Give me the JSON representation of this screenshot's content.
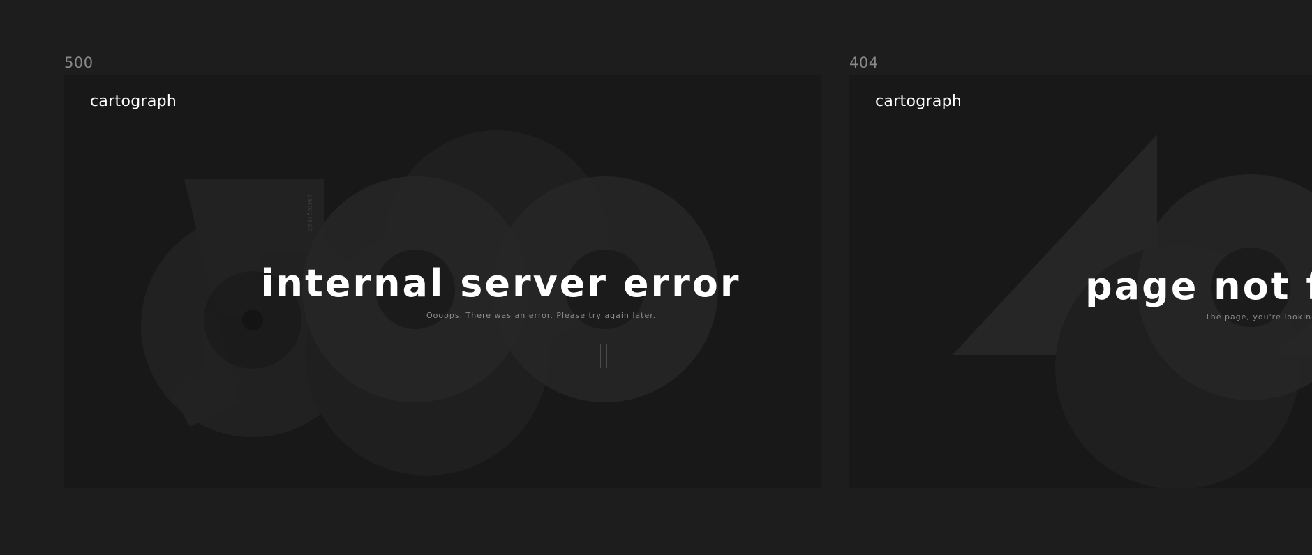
{
  "frames": [
    {
      "label": "500",
      "brand": "cartograph",
      "headline": "internal server error",
      "message": "Oooops. There was an error. Please try again later.",
      "vertical_text": "cartograph"
    },
    {
      "label": "404",
      "brand": "cartograph",
      "headline": "page not fou",
      "message": "The page, you're looking fo"
    }
  ],
  "colors": {
    "page_background": "#1d1d1d",
    "frame_background": "#181818",
    "shape_fill": "#262626",
    "text_primary": "#ffffff",
    "text_muted": "#8d8d8d"
  }
}
